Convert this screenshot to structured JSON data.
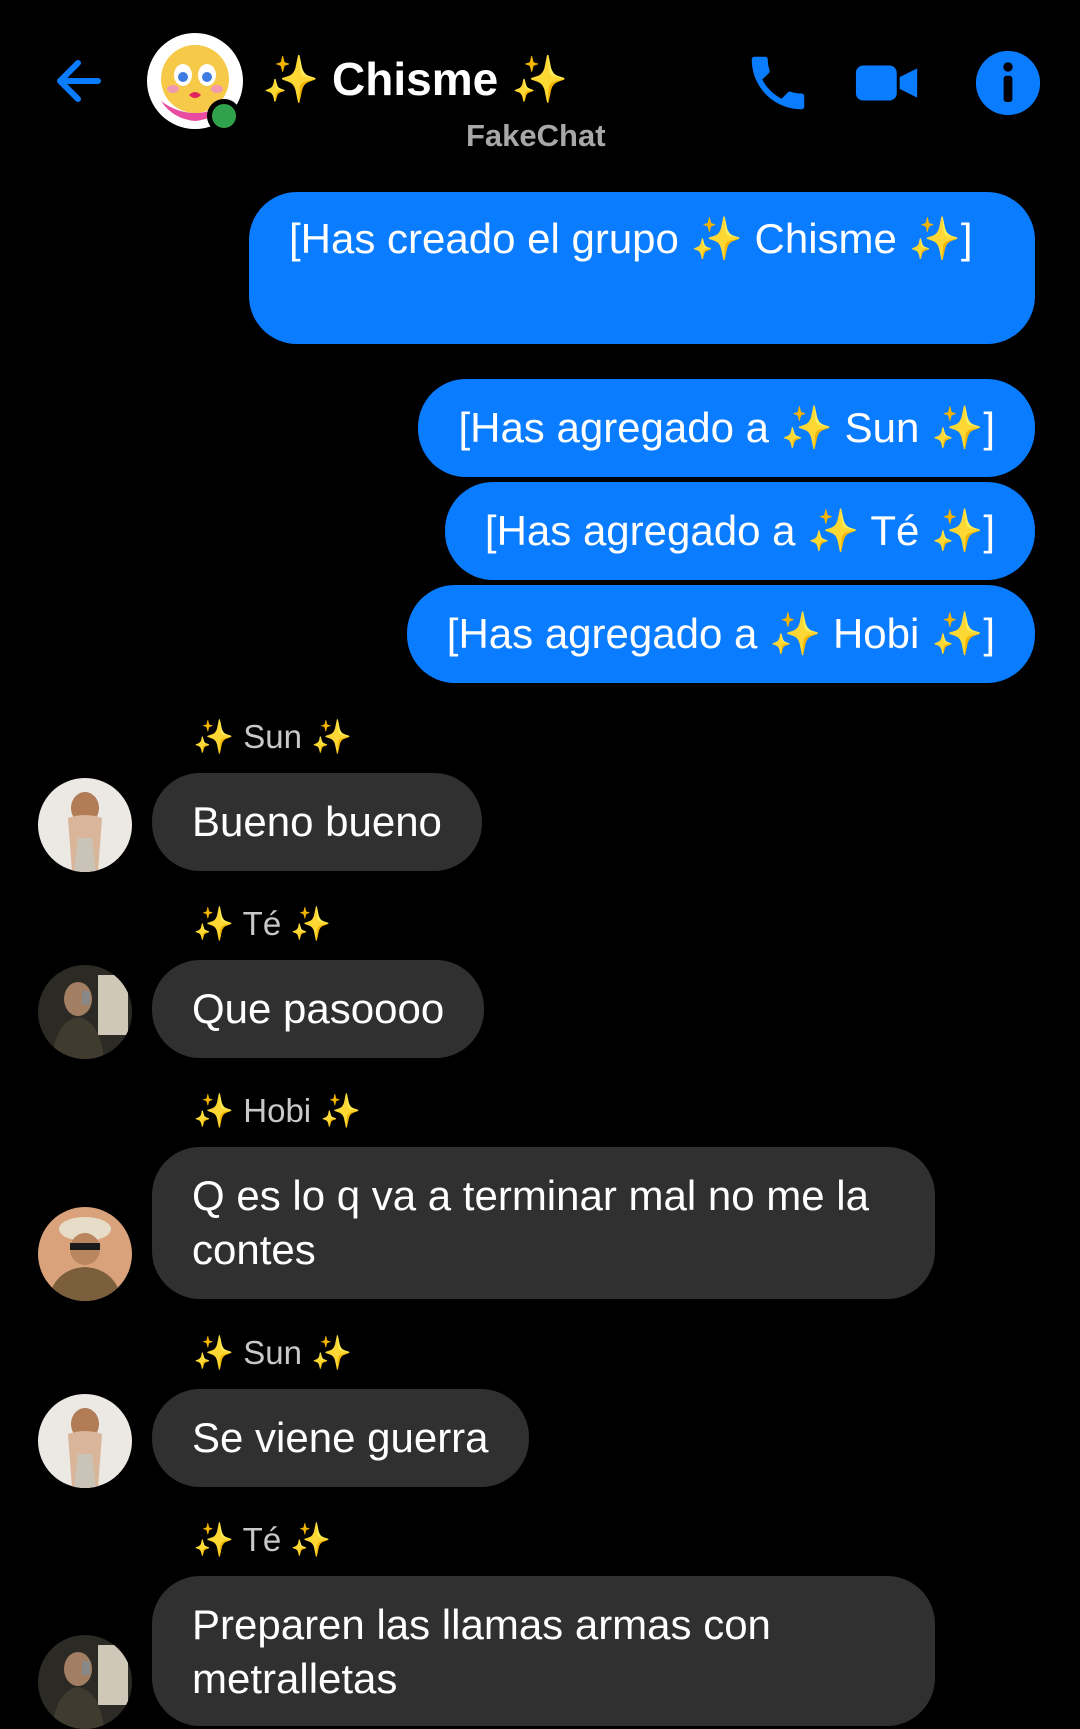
{
  "header": {
    "title": "✨ Chisme ✨",
    "subtitle": "FakeChat",
    "back_icon": "back-arrow-icon",
    "call_icon": "phone-icon",
    "video_icon": "video-camera-icon",
    "info_icon": "info-icon",
    "accent_color": "#0a7cff",
    "online_color": "#31a24c"
  },
  "outgoing": [
    {
      "text": "[Has creado el grupo ✨ Chisme ✨]"
    },
    {
      "text": "[Has agregado a ✨ Sun ✨]"
    },
    {
      "text": "[Has agregado a ✨ Té ✨]"
    },
    {
      "text": "[Has agregado a ✨ Hobi ✨]"
    }
  ],
  "incoming": [
    {
      "sender": "✨ Sun ✨",
      "text": "Bueno bueno"
    },
    {
      "sender": "✨ Té ✨",
      "text": "Que pasoooo"
    },
    {
      "sender": "✨ Hobi ✨",
      "text": "Q es lo q va a terminar mal no me la contes"
    },
    {
      "sender": "✨ Sun ✨",
      "text": "Se viene guerra"
    },
    {
      "sender": "✨ Té ✨",
      "text": "Preparen las llamas armas con metralletas"
    }
  ]
}
